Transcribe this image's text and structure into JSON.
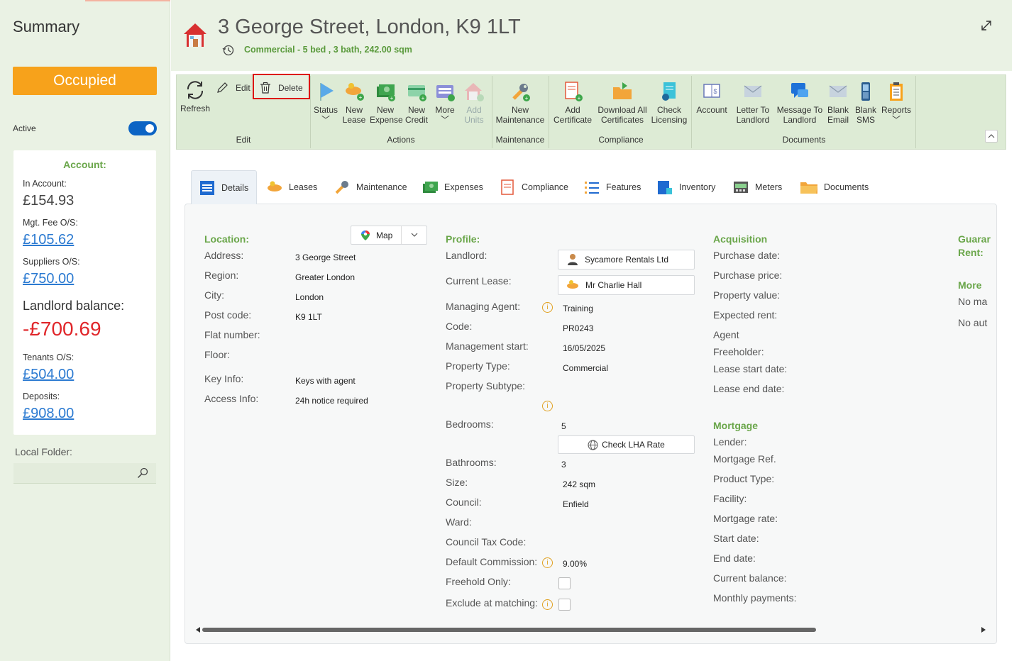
{
  "summary": {
    "title": "Summary",
    "status": "Occupied",
    "active_label": "Active",
    "active": true,
    "account": {
      "header": "Account:",
      "in_account_label": "In Account:",
      "in_account": "£154.93",
      "mgt_fee_label": "Mgt. Fee O/S:",
      "mgt_fee": "£105.62",
      "suppliers_label": "Suppliers O/S:",
      "suppliers": "£750.00",
      "landlord_balance_label": "Landlord balance:",
      "landlord_balance": "-£700.69",
      "tenants_label": "Tenants O/S:",
      "tenants": "£504.00",
      "deposits_label": "Deposits:",
      "deposits": "£908.00"
    },
    "local_folder_label": "Local Folder:",
    "local_folder_value": ""
  },
  "header": {
    "title": "3 George Street, London, K9 1LT",
    "subtitle": "Commercial - 5 bed , 3 bath, 242.00 sqm"
  },
  "ribbon": {
    "edit_group": {
      "label": "Edit",
      "refresh": "Refresh",
      "edit": "Edit",
      "delete": "Delete"
    },
    "actions_group": {
      "label": "Actions",
      "status": "Status",
      "new_lease": [
        "New",
        "Lease"
      ],
      "new_expense": [
        "New",
        "Expense"
      ],
      "new_credit": [
        "New",
        "Credit"
      ],
      "more": "More",
      "add_units": [
        "Add",
        "Units"
      ]
    },
    "maintenance_group": {
      "label": "Maintenance",
      "new_maintenance": [
        "New",
        "Maintenance"
      ]
    },
    "compliance_group": {
      "label": "Compliance",
      "add_certificate": [
        "Add",
        "Certificate"
      ],
      "download_all": [
        "Download All",
        "Certificates"
      ],
      "check_licensing": [
        "Check",
        "Licensing"
      ]
    },
    "documents_group": {
      "label": "Documents",
      "account": "Account",
      "letter_to_landlord": [
        "Letter To",
        "Landlord"
      ],
      "message_to_landlord": [
        "Message To",
        "Landlord"
      ],
      "blank_email": [
        "Blank",
        "Email"
      ],
      "blank_sms": [
        "Blank",
        "SMS"
      ],
      "reports": "Reports"
    }
  },
  "tabs": [
    "Details",
    "Leases",
    "Maintenance",
    "Expenses",
    "Compliance",
    "Features",
    "Inventory",
    "Meters",
    "Documents"
  ],
  "location": {
    "header": "Location:",
    "map_button": "Map",
    "address_label": "Address:",
    "address": "3 George Street",
    "region_label": "Region:",
    "region": "Greater London",
    "city_label": "City:",
    "city": "London",
    "postcode_label": "Post code:",
    "postcode": "K9 1LT",
    "flat_label": "Flat number:",
    "floor_label": "Floor:",
    "key_info_label": "Key Info:",
    "key_info": "Keys with agent",
    "access_info_label": "Access Info:",
    "access_info": "24h notice required"
  },
  "profile": {
    "header": "Profile:",
    "landlord_label": "Landlord:",
    "landlord": "Sycamore Rentals Ltd",
    "current_lease_label": "Current Lease:",
    "current_lease": "Mr Charlie Hall",
    "managing_agent_label": "Managing Agent:",
    "managing_agent": "Training",
    "code_label": "Code:",
    "code": "PR0243",
    "mgmt_start_label": "Management start:",
    "mgmt_start": "16/05/2025",
    "property_type_label": "Property Type:",
    "property_type": "Commercial",
    "property_subtype_label": "Property Subtype:",
    "bedrooms_label": "Bedrooms:",
    "bedrooms": "5",
    "check_lha": "Check LHA Rate",
    "bathrooms_label": "Bathrooms:",
    "bathrooms": "3",
    "size_label": "Size:",
    "size": "242 sqm",
    "council_label": "Council:",
    "council": "Enfield",
    "ward_label": "Ward:",
    "council_tax_label": "Council Tax Code:",
    "default_commission_label": "Default Commission:",
    "default_commission": "9.00%",
    "freehold_label": "Freehold Only:",
    "exclude_label": "Exclude at matching:"
  },
  "acquisition": {
    "header": "Acquisition",
    "purchase_date": "Purchase date:",
    "purchase_price": "Purchase price:",
    "property_value": "Property value:",
    "expected_rent": "Expected rent:",
    "agent": "Agent",
    "freeholder": "Freeholder:",
    "lease_start": "Lease start date:",
    "lease_end": "Lease end date:"
  },
  "mortgage": {
    "header": "Mortgage",
    "lender": "Lender:",
    "mortgage_ref": "Mortgage Ref.",
    "product_type": "Product Type:",
    "facility": "Facility:",
    "mortgage_rate": "Mortgage rate:",
    "start_date": "Start date:",
    "end_date": "End date:",
    "current_balance": "Current balance:",
    "monthly_payments": "Monthly payments:"
  },
  "guarantee": {
    "header1": "Guarar",
    "header2": "Rent:",
    "more_header": "More",
    "line1": "No ma",
    "line2": "No aut"
  },
  "colors": {
    "accent_green": "#6aa64a",
    "occupied_orange": "#f7a21b",
    "negative_red": "#e0262a",
    "link_blue": "#2b7ad1"
  }
}
